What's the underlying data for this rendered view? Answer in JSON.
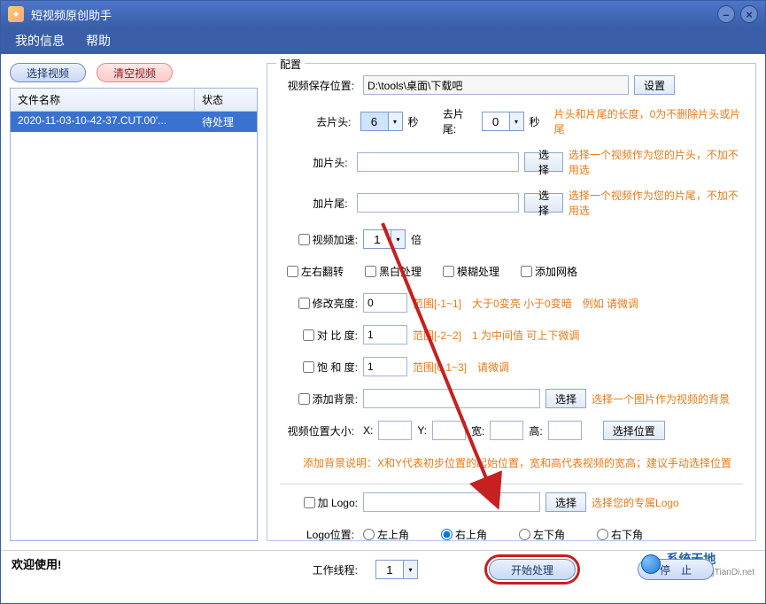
{
  "window": {
    "title": "短视频原创助手"
  },
  "menu": {
    "info": "我的信息",
    "help": "帮助"
  },
  "left": {
    "select_btn": "选择视频",
    "clear_btn": "清空视频",
    "col_name": "文件名称",
    "col_status": "状态",
    "rows": [
      {
        "name": "2020-11-03-10-42-37.CUT.00'...",
        "status": "待处理"
      }
    ]
  },
  "config": {
    "legend": "配置",
    "save_path_lbl": "视频保存位置:",
    "save_path": "D:\\tools\\桌面\\下载吧",
    "set_btn": "设置",
    "trim_head_lbl": "去片头:",
    "trim_head": "6",
    "sec": "秒",
    "trim_tail_lbl": "去片尾:",
    "trim_tail": "0",
    "trim_hint": "片头和片尾的长度，0为不删除片头或片尾",
    "add_head_lbl": "加片头:",
    "add_head": "",
    "choose": "选择",
    "add_head_hint": "选择一个视频作为您的片头，不加不用选",
    "add_tail_lbl": "加片尾:",
    "add_tail": "",
    "add_tail_hint": "选择一个视频作为您的片尾，不加不用选",
    "speed_lbl": "视频加速:",
    "speed": "1",
    "speed_unit": "倍",
    "flip_lbl": "左右翻转",
    "bw_lbl": "黑白处理",
    "blur_lbl": "模糊处理",
    "grid_lbl": "添加网格",
    "bright_lbl": "修改亮度:",
    "bright": "0",
    "bright_hint": "范围[-1~1]　大于0变亮 小于0变暗　例如 请微调",
    "contrast_lbl": "对 比 度:",
    "contrast": "1",
    "contrast_hint": "范围[-2~2]　1 为中间值 可上下微调",
    "sat_lbl": "饱 和 度:",
    "sat": "1",
    "sat_hint": "范围[0.1~3]　请微调",
    "bg_lbl": "添加背景:",
    "bg": "",
    "bg_hint": "选择一个图片作为视频的背景",
    "pos_lbl": "视频位置大小:",
    "x_lbl": "X:",
    "y_lbl": "Y:",
    "w_lbl": "宽:",
    "h_lbl": "高:",
    "pos_btn": "选择位置",
    "bg_note": "添加背景说明：X和Y代表初步位置的起始位置，宽和高代表视频的宽高；建议手动选择位置",
    "logo_lbl": "加 Logo:",
    "logo": "",
    "logo_hint": "选择您的专属Logo",
    "logo_pos_lbl": "Logo位置:",
    "logo_tl": "左上角",
    "logo_tr": "右上角",
    "logo_bl": "左下角",
    "logo_br": "右下角",
    "threads_lbl": "工作线程:",
    "threads": "1",
    "start_btn": "开始处理",
    "stop_btn": "停　止"
  },
  "status": {
    "welcome": "欢迎使用!",
    "brand": "系统天地",
    "url": "www.XiTongTianDi.net"
  }
}
